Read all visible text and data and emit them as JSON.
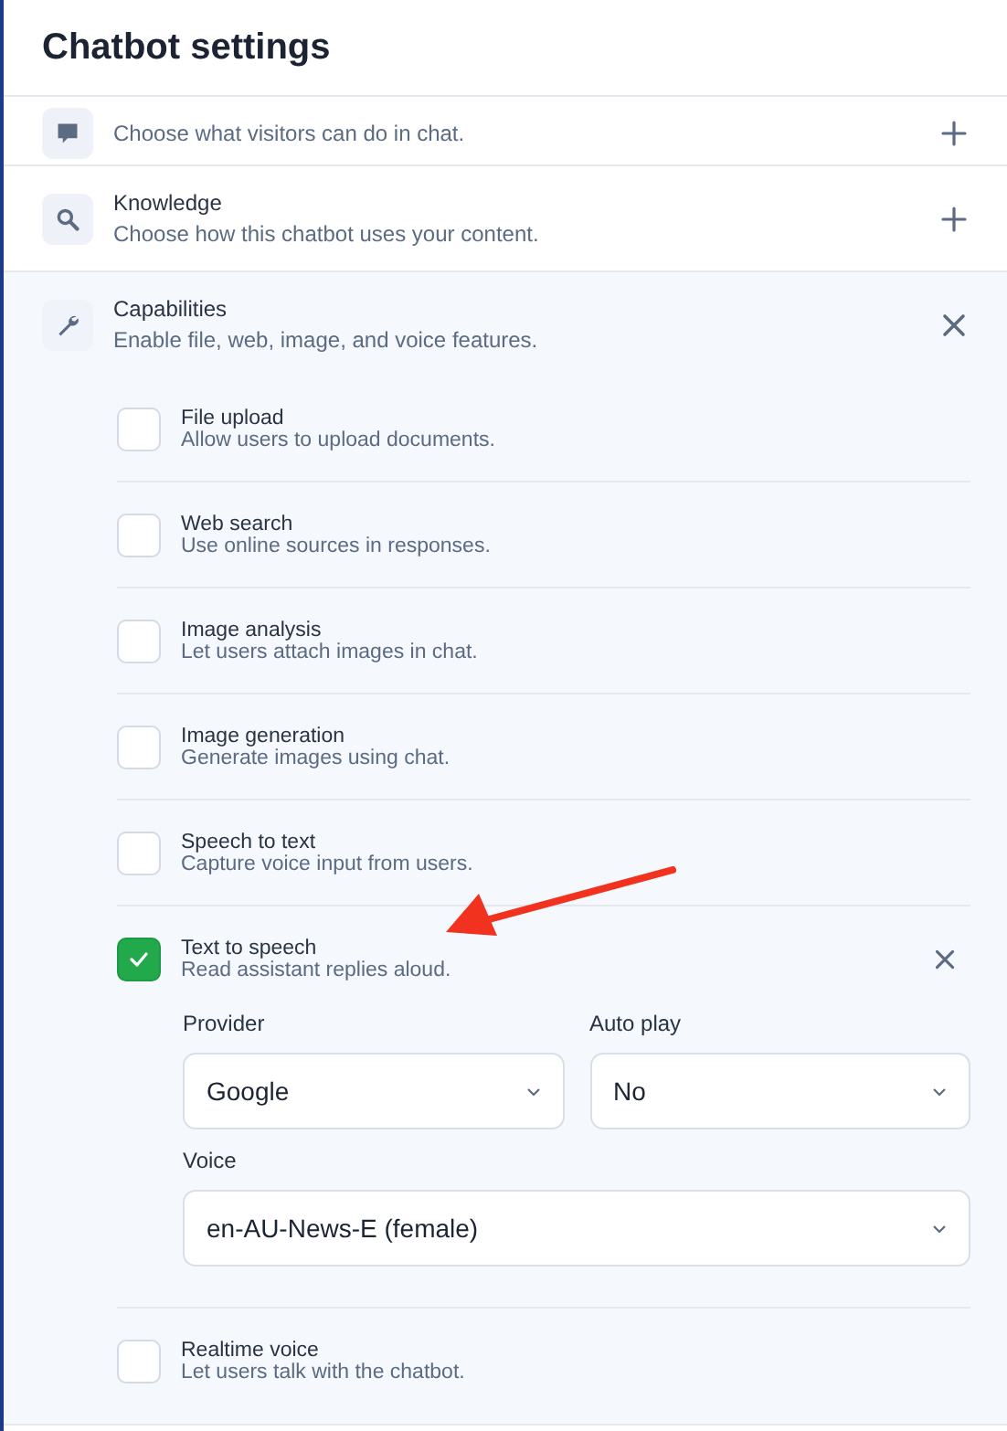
{
  "header": {
    "title": "Chatbot settings"
  },
  "sections": [
    {
      "description": "Choose what visitors can do in chat.",
      "expanded": false
    },
    {
      "title": "Knowledge",
      "description": "Choose how this chatbot uses your content.",
      "expanded": false
    },
    {
      "title": "Capabilities",
      "description": "Enable file, web, image, and voice features.",
      "expanded": true,
      "items": [
        {
          "title": "File upload",
          "description": "Allow users to upload documents.",
          "checked": false,
          "expanded": false
        },
        {
          "title": "Web search",
          "description": "Use online sources in responses.",
          "checked": false,
          "expanded": false
        },
        {
          "title": "Image analysis",
          "description": "Let users attach images in chat.",
          "checked": false,
          "expanded": false
        },
        {
          "title": "Image generation",
          "description": "Generate images using chat.",
          "checked": false,
          "expanded": false
        },
        {
          "title": "Speech to text",
          "description": "Capture voice input from users.",
          "checked": false,
          "expanded": false
        },
        {
          "title": "Text to speech",
          "description": "Read assistant replies aloud.",
          "checked": true,
          "expanded": true,
          "fields": [
            {
              "label": "Provider",
              "value": "Google"
            },
            {
              "label": "Auto play",
              "value": "No"
            },
            {
              "label": "Voice",
              "value": "en-AU-News-E (female)"
            }
          ]
        },
        {
          "title": "Realtime voice",
          "description": "Let users talk with the chatbot.",
          "checked": false,
          "expanded": false
        }
      ]
    }
  ]
}
